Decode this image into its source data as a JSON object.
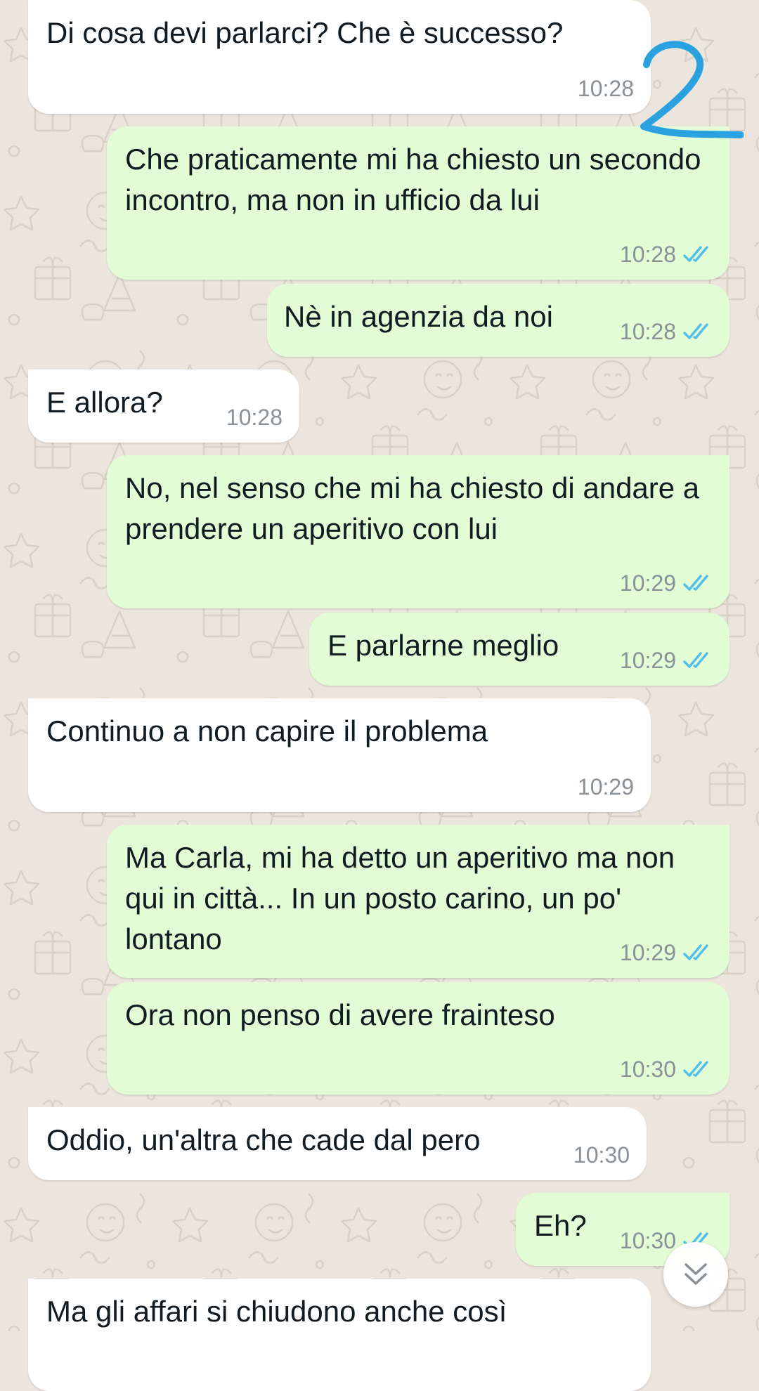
{
  "messages": [
    {
      "direction": "in",
      "text": "Di cosa devi parlarci? Che è successo?",
      "time": "10:28"
    },
    {
      "direction": "out",
      "text": "Che praticamente mi ha chiesto un secondo incontro, ma non in ufficio da lui",
      "time": "10:28",
      "status": "read"
    },
    {
      "direction": "out",
      "text": "Nè in agenzia da noi",
      "time": "10:28",
      "status": "read"
    },
    {
      "direction": "in",
      "text": "E allora?",
      "time": "10:28"
    },
    {
      "direction": "out",
      "text": "No, nel senso che mi ha chiesto di andare a prendere un aperitivo con lui",
      "time": "10:29",
      "status": "read"
    },
    {
      "direction": "out",
      "text": "E parlarne meglio",
      "time": "10:29",
      "status": "read"
    },
    {
      "direction": "in",
      "text": "Continuo a non capire il problema",
      "time": "10:29"
    },
    {
      "direction": "out",
      "text": "Ma Carla, mi ha detto un aperitivo ma non qui in città... In un posto carino, un po' lontano",
      "time": "10:29",
      "status": "read"
    },
    {
      "direction": "out",
      "text": "Ora non penso di avere frainteso",
      "time": "10:30",
      "status": "read"
    },
    {
      "direction": "in",
      "text": "Oddio, un'altra che cade dal pero",
      "time": "10:30"
    },
    {
      "direction": "out",
      "text": "Eh?",
      "time": "10:30",
      "status": "read"
    },
    {
      "direction": "in",
      "text": "Ma gli affari si chiudono anche così",
      "time": ""
    }
  ],
  "annotation": {
    "text": "2",
    "color": "#2aa2e0"
  },
  "colors": {
    "incoming_bubble": "#ffffff",
    "outgoing_bubble": "#e2fdd5",
    "read_ticks": "#53bdeb",
    "wallpaper": "#ece5dd"
  },
  "scroll_button": {
    "icon": "double-chevron-down-icon"
  }
}
